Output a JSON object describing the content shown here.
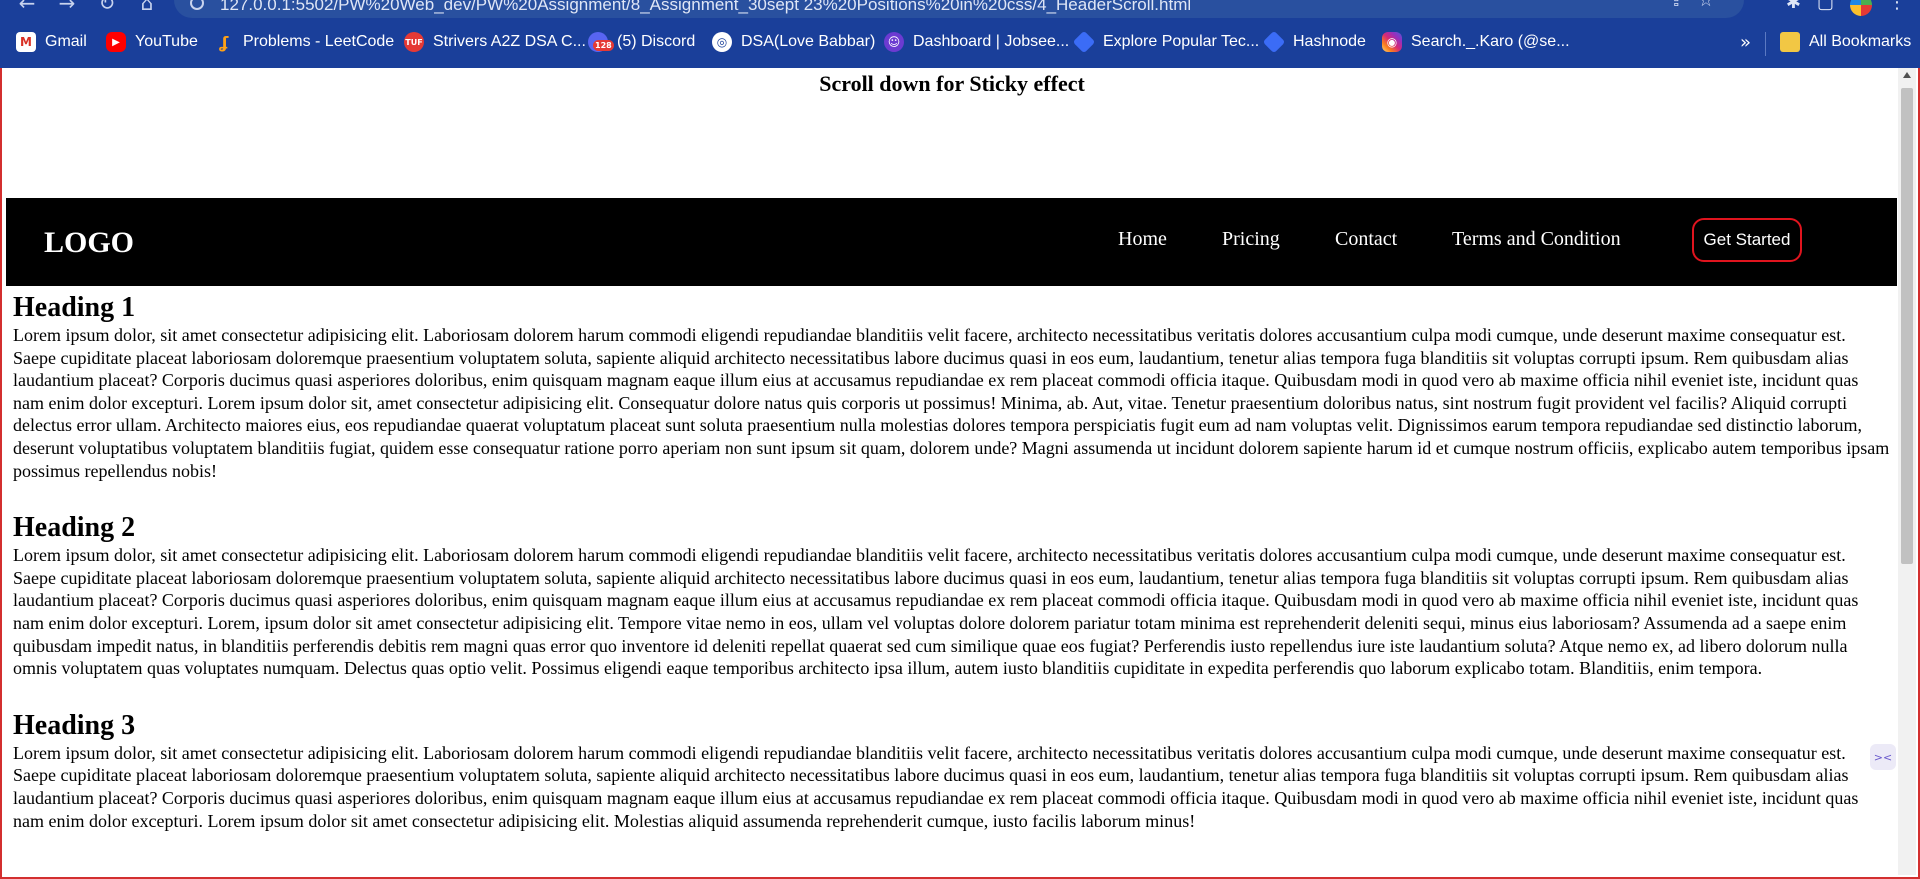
{
  "browser": {
    "url": "127.0.0.1:5502/PW%20Web_dev/PW%20Assignment/8_Assignment_30sept 23%20Positions%20in%20css/4_HeaderScroll.html",
    "bookmarks": [
      {
        "label": "Gmail",
        "icon": "gmail-icon",
        "glyph": "M"
      },
      {
        "label": "YouTube",
        "icon": "youtube-icon",
        "glyph": "▶"
      },
      {
        "label": "Problems - LeetCode",
        "icon": "leetcode-icon",
        "glyph": "ʆ"
      },
      {
        "label": "Strivers A2Z DSA C...",
        "icon": "tuf-icon",
        "glyph": "TUF"
      },
      {
        "label": "(5) Discord",
        "icon": "discord-icon",
        "glyph": "",
        "badge": "128"
      },
      {
        "label": "DSA(Love Babbar)",
        "icon": "dsa-icon",
        "glyph": "◎"
      },
      {
        "label": "Dashboard | Jobsee...",
        "icon": "jobsee-icon",
        "glyph": "☺"
      },
      {
        "label": "Explore Popular Tec...",
        "icon": "diamond-icon",
        "glyph": ""
      },
      {
        "label": "Hashnode",
        "icon": "hashnode-icon",
        "glyph": ""
      },
      {
        "label": "Search._.Karo (@se...",
        "icon": "instagram-icon",
        "glyph": "◉"
      }
    ],
    "more_glyph": "»",
    "all_bookmarks": "All Bookmarks"
  },
  "page": {
    "scroll_message": "Scroll down for Sticky effect",
    "header": {
      "logo": "LOGO",
      "nav": [
        "Home",
        "Pricing",
        "Contact",
        "Terms and Condition"
      ],
      "cta": "Get Started"
    },
    "sections": [
      {
        "heading": "Heading 1",
        "body": "Lorem ipsum dolor, sit amet consectetur adipisicing elit. Laboriosam dolorem harum commodi eligendi repudiandae blanditiis velit facere, architecto necessitatibus veritatis dolores accusantium culpa modi cumque, unde deserunt maxime consequatur est. Saepe cupiditate placeat laboriosam doloremque praesentium voluptatem soluta, sapiente aliquid architecto necessitatibus labore ducimus quasi in eos eum, laudantium, tenetur alias tempora fuga blanditiis sit voluptas corrupti ipsum. Rem quibusdam alias laudantium placeat? Corporis ducimus quasi asperiores doloribus, enim quisquam magnam eaque illum eius at accusamus repudiandae ex rem placeat commodi officia itaque. Quibusdam modi in quod vero ab maxime officia nihil eveniet iste, incidunt quas nam enim dolor excepturi. Lorem ipsum dolor sit, amet consectetur adipisicing elit. Consequatur dolore natus quis corporis ut possimus! Minima, ab. Aut, vitae. Tenetur praesentium doloribus natus, sint nostrum fugit provident vel facilis? Aliquid corrupti delectus error ullam. Architecto maiores eius, eos repudiandae quaerat voluptatum placeat sunt soluta praesentium nulla molestias dolores tempora perspiciatis fugit eum ad nam voluptas velit. Dignissimos earum tempora repudiandae sed distinctio laborum, deserunt voluptatibus voluptatem blanditiis fugiat, quidem esse consequatur ratione porro aperiam non sunt ipsum sit quam, dolorem unde? Magni assumenda ut incidunt dolorem sapiente harum id et cumque nostrum officiis, explicabo autem temporibus ipsam possimus repellendus nobis!"
      },
      {
        "heading": "Heading 2",
        "body": "Lorem ipsum dolor, sit amet consectetur adipisicing elit. Laboriosam dolorem harum commodi eligendi repudiandae blanditiis velit facere, architecto necessitatibus veritatis dolores accusantium culpa modi cumque, unde deserunt maxime consequatur est. Saepe cupiditate placeat laboriosam doloremque praesentium voluptatem soluta, sapiente aliquid architecto necessitatibus labore ducimus quasi in eos eum, laudantium, tenetur alias tempora fuga blanditiis sit voluptas corrupti ipsum. Rem quibusdam alias laudantium placeat? Corporis ducimus quasi asperiores doloribus, enim quisquam magnam eaque illum eius at accusamus repudiandae ex rem placeat commodi officia itaque. Quibusdam modi in quod vero ab maxime officia nihil eveniet iste, incidunt quas nam enim dolor excepturi. Lorem, ipsum dolor sit amet consectetur adipisicing elit. Tempore vitae nemo in eos, ullam vel voluptas dolore dolorem pariatur totam minima est reprehenderit deleniti sequi, minus eius laboriosam? Assumenda ad a saepe enim quibusdam impedit natus, in blanditiis perferendis debitis rem magni quas error quo inventore id deleniti repellat quaerat sed cum similique quae eos fugiat? Perferendis iusto repellendus iure iste laudantium soluta? Atque nemo ex, ad libero dolorum nulla omnis voluptatem quas voluptates numquam. Delectus quas optio velit. Possimus eligendi eaque temporibus architecto ipsa illum, autem iusto blanditiis cupiditate in expedita perferendis quo laborum explicabo totam. Blanditiis, enim tempora."
      },
      {
        "heading": "Heading 3",
        "body": "Lorem ipsum dolor, sit amet consectetur adipisicing elit. Laboriosam dolorem harum commodi eligendi repudiandae blanditiis velit facere, architecto necessitatibus veritatis dolores accusantium culpa modi cumque, unde deserunt maxime consequatur est. Saepe cupiditate placeat laboriosam doloremque praesentium voluptatem soluta, sapiente aliquid architecto necessitatibus labore ducimus quasi in eos eum, laudantium, tenetur alias tempora fuga blanditiis sit voluptas corrupti ipsum. Rem quibusdam alias laudantium placeat? Corporis ducimus quasi asperiores doloribus, enim quisquam magnam eaque illum eius at accusamus repudiandae ex rem placeat commodi officia itaque. Quibusdam modi in quod vero ab maxime officia nihil eveniet iste, incidunt quas nam enim dolor excepturi. Lorem ipsum dolor sit amet consectetur adipisicing elit. Molestias aliquid assumenda reprehenderit cumque, iusto facilis laborum minus!"
      }
    ]
  },
  "colors": {
    "chrome": "#1a3f9a",
    "header_bg": "#000000",
    "cta_border": "#e0141e"
  }
}
